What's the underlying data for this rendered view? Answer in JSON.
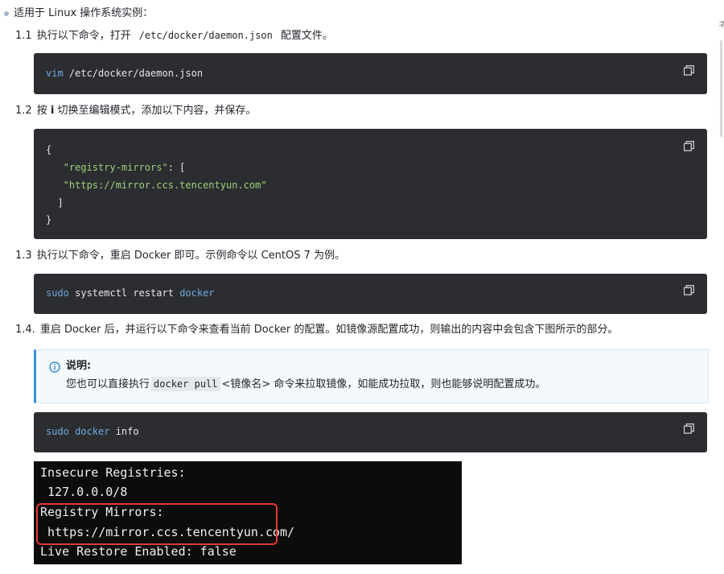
{
  "intro": "适用于 Linux 操作系统实例：",
  "steps": [
    {
      "num": "1.1",
      "before": "执行以下命令，打开",
      "code": "/etc/docker/daemon.json",
      "after": "配置文件。"
    },
    {
      "num": "1.2",
      "prefix": "按",
      "key": "i",
      "text": "切换至编辑模式，添加以下内容，并保存。"
    },
    {
      "num": "1.3",
      "text": "执行以下命令，重启 Docker 即可。示例命令以 CentOS 7 为例。"
    },
    {
      "num": "1.4.",
      "text": "重启 Docker 后，并运行以下命令来查看当前 Docker 的配置。如镜像源配置成功，则输出的内容中会包含下图所示的部分。"
    }
  ],
  "code1": {
    "cmd": "vim",
    "arg": " /etc/docker/daemon.json"
  },
  "code2": {
    "open_brace": "{",
    "key": "\"registry-mirrors\"",
    "colon": ": [",
    "url": "\"https://mirror.ccs.tencentyun.com\"",
    "close_bracket": "]",
    "close_brace": "}"
  },
  "code3": {
    "sudo": "sudo",
    "cmd": " systemctl restart ",
    "target": "docker"
  },
  "note": {
    "title": "说明:",
    "before": "您也可以直接执行",
    "code": "docker pull",
    "middle": "<镜像名> 命令来拉取镜像，如能成功拉取，则也能够说明配置成功。"
  },
  "code4": {
    "sudo": "sudo",
    "docker": " docker ",
    "info": "info"
  },
  "terminal": [
    "Insecure Registries:",
    " 127.0.0.0/8",
    "Registry Mirrors:",
    " https://mirror.ccs.tencentyun.com/",
    "Live Restore Enabled: false"
  ],
  "edge_glyph": "ネ",
  "colors": {
    "accent": "#3b8fd9",
    "highlight": "#e53935",
    "code_bg": "#2b2d31"
  },
  "icons": {
    "copy": "copy-icon",
    "info": "info-circle-icon"
  }
}
